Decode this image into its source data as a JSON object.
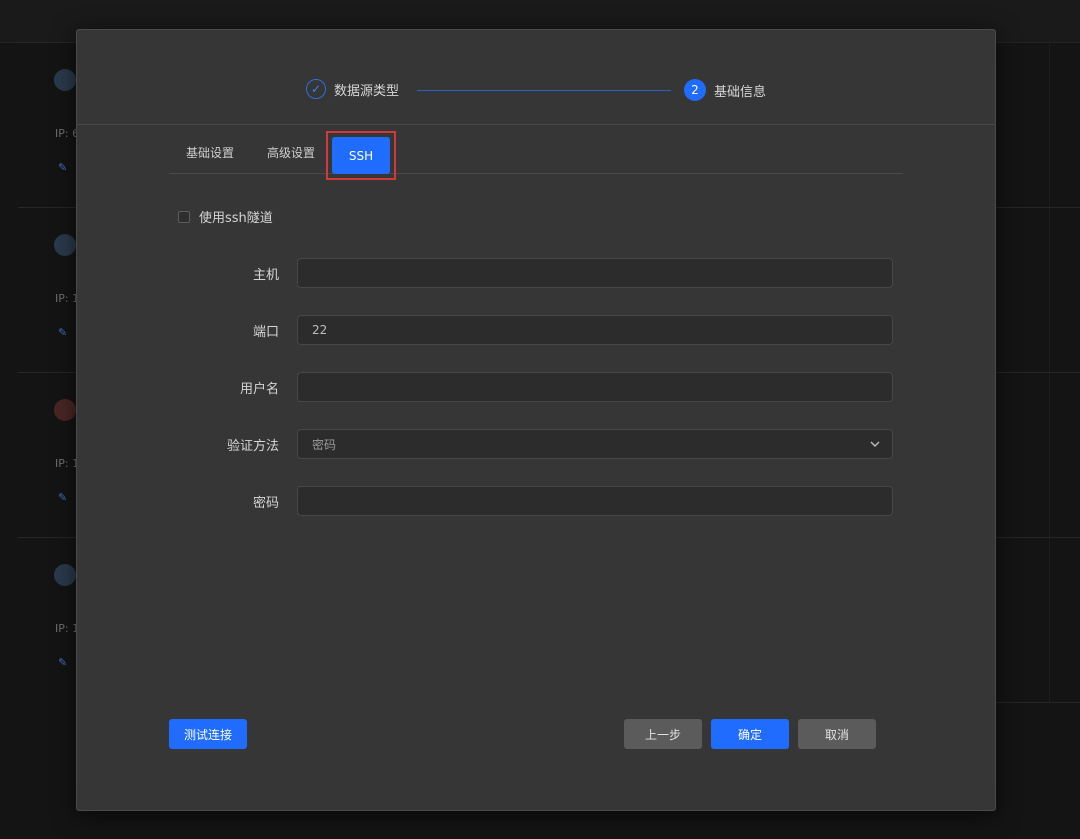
{
  "background": {
    "cards": [
      {
        "ip_label": "IP: 6"
      },
      {
        "ip_label": "IP: 1"
      },
      {
        "ip_label": "IP: 1"
      },
      {
        "ip_label": "IP: 1"
      }
    ]
  },
  "modal": {
    "steps": [
      {
        "label": "数据源类型",
        "state": "done"
      },
      {
        "number": "2",
        "label": "基础信息",
        "state": "active"
      }
    ],
    "tabs": {
      "basic": "基础设置",
      "advanced": "高级设置",
      "ssh": "SSH",
      "active": "ssh"
    },
    "ssh_tunnel": {
      "label": "使用ssh隧道",
      "checked": false
    },
    "form": {
      "host": {
        "label": "主机",
        "value": ""
      },
      "port": {
        "label": "端口",
        "value": "22"
      },
      "username": {
        "label": "用户名",
        "value": ""
      },
      "auth_method": {
        "label": "验证方法",
        "selected": "密码"
      },
      "password": {
        "label": "密码",
        "value": ""
      }
    },
    "buttons": {
      "test_connection": "测试连接",
      "previous": "上一步",
      "confirm": "确定",
      "cancel": "取消"
    }
  },
  "colors": {
    "accent": "#1f6cff",
    "highlight_border": "#d23a3a",
    "modal_bg": "#363636",
    "page_bg": "#141414"
  }
}
